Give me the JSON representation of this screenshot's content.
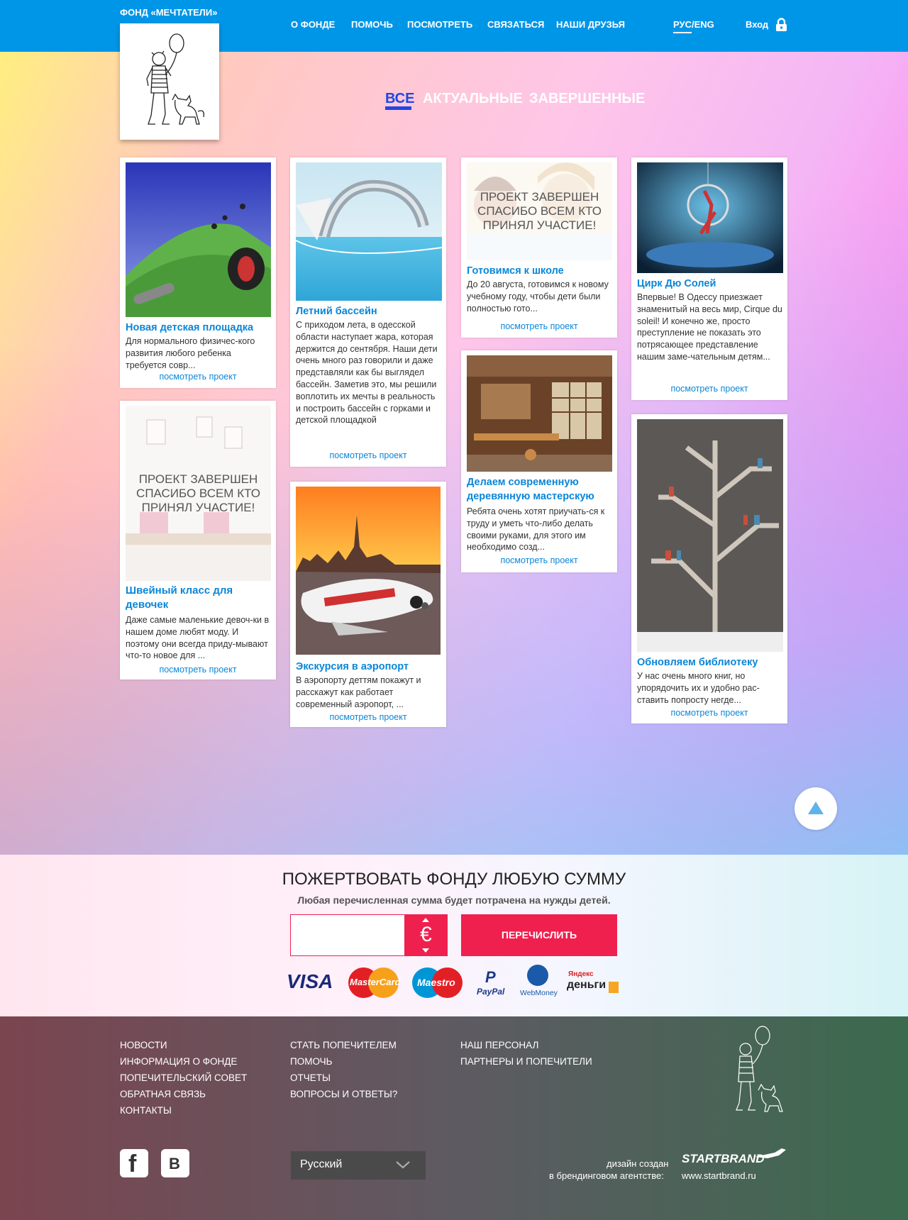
{
  "header": {
    "brand": "ФОНД «МЕЧТАТЕЛИ»",
    "nav": [
      "О ФОНДЕ",
      "ПОМОЧЬ",
      "ПОСМОТРЕТЬ",
      "СВЯЗАТЬСЯ",
      "НАШИ ДРУЗЬЯ"
    ],
    "lang": "РУС/ENG",
    "login": "Вход"
  },
  "filters": [
    "ВСЕ",
    "АКТУАЛЬНЫЕ",
    "ЗАВЕРШЕННЫЕ"
  ],
  "more_label": "посмотреть проект",
  "cards": [
    {
      "title": "Новая детская площадка",
      "desc": "Для нормального физичес-кого развития любого ребенка требуется совр..."
    },
    {
      "title": "Швейный класс для девочек",
      "desc": "Даже самые маленькие девоч-ки в нашем доме любят моду. И поэтому они всегда приду-мывают что-то новое для ...",
      "overlay": "ПРОЕКТ ЗАВЕРШЕН СПАСИБО ВСЕМ КТО ПРИНЯЛ УЧАСТИЕ!"
    },
    {
      "title": "Летний бассейн",
      "desc": "С приходом лета, в одесской области наступает жара, которая держится до сентября. Наши дети очень много раз говорили и даже представляли как бы выглядел бассейн. Заметив это, мы решили воплотить их мечты в реальность и построить бассейн с горками и детской площадкой"
    },
    {
      "title": "Экскурсия в аэропорт",
      "desc": "В аэропорту деттям покажут и расскажут как работает современный аэропорт, ..."
    },
    {
      "title": "Готовимся к школе",
      "desc": "До 20 августа, готовимся к новому учебному году, чтобы дети были полностью гото...",
      "overlay": "ПРОЕКТ ЗАВЕРШЕН СПАСИБО ВСЕМ КТО ПРИНЯЛ УЧАСТИЕ!"
    },
    {
      "title": "Делаем современную деревянную мастерскую",
      "desc": "Ребята очень хотят приучать-ся к труду и уметь что-либо делать своими руками, для этого им необходимо созд..."
    },
    {
      "title": "Цирк Дю Солей",
      "desc": "Впервые! В Одессу приезжает знаменитый на весь мир, Cirque du soleil! И конечно же, просто преступление не показать это потрясающее представление нашим заме-чательным детям..."
    },
    {
      "title": "Обновляем библиотеку",
      "desc": "У нас очень много книг, но упорядочить их и удобно рас-ставить попросту негде..."
    }
  ],
  "donate": {
    "title": "ПОЖЕРТВОВАТЬ ФОНДУ ЛЮБУЮ СУММУ",
    "subtitle": "Любая перечисленная сумма будет потрачена на нужды детей.",
    "amount": "",
    "currency": "€",
    "button": "ПЕРЕЧИСЛИТЬ",
    "payments": [
      "VISA",
      "MasterCard",
      "Maestro",
      "PayPal",
      "WebMoney",
      "Яндекс",
      "деньги"
    ]
  },
  "footer": {
    "col1": [
      "НОВОСТИ",
      "ИНФОРМАЦИЯ О ФОНДЕ",
      "ПОПЕЧИТЕЛЬСКИЙ СОВЕТ",
      "ОБРАТНАЯ СВЯЗЬ",
      "КОНТАКТЫ"
    ],
    "col2": [
      "СТАТЬ ПОПЕЧИТЕЛЕМ",
      "ПОМОЧЬ",
      "ОТЧЕТЫ",
      "ВОПРОСЫ И ОТВЕТЫ?"
    ],
    "col3": [
      "НАШ ПЕРСОНАЛ",
      "ПАРТНЕРЫ И ПОПЕЧИТЕЛИ"
    ],
    "language": "Русский",
    "credit1": "дизайн создан",
    "credit2": "в брендинговом агентстве:",
    "agency": "STARTBRAND",
    "agency_url": "www.startbrand.ru"
  },
  "colors": {
    "topbar": "#0096e8",
    "accent": "#f0204e",
    "link": "#0a86d8",
    "filter_active": "#1f46e6"
  }
}
